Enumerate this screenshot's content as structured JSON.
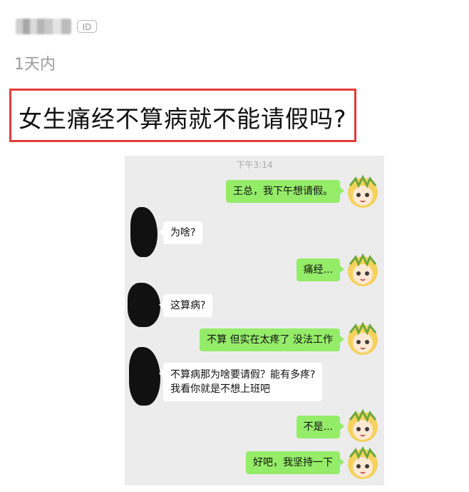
{
  "post": {
    "author_tag": "ID",
    "time": "1天内",
    "question": "女生痛经不算病就不能请假吗?"
  },
  "chat": {
    "timestamp": "下午3:14",
    "messages": [
      {
        "side": "right",
        "text": "王总，我下午想请假。"
      },
      {
        "side": "left",
        "text": "为啥?"
      },
      {
        "side": "right",
        "text": "痛经..."
      },
      {
        "side": "left",
        "text": "这算病?"
      },
      {
        "side": "right",
        "text": "不算 但实在太疼了 没法工作"
      },
      {
        "side": "left",
        "lines": [
          "不算病那为啥要请假？能有多疼?",
          "我看你就是不想上班吧"
        ]
      },
      {
        "side": "right",
        "text": "不是..."
      },
      {
        "side": "right",
        "text": "好吧，我坚持一下"
      }
    ],
    "colors": {
      "sent_bubble": "#95ec69",
      "received_bubble": "#ffffff",
      "chat_background": "#ececec",
      "highlight_border": "#e23b3b"
    }
  }
}
